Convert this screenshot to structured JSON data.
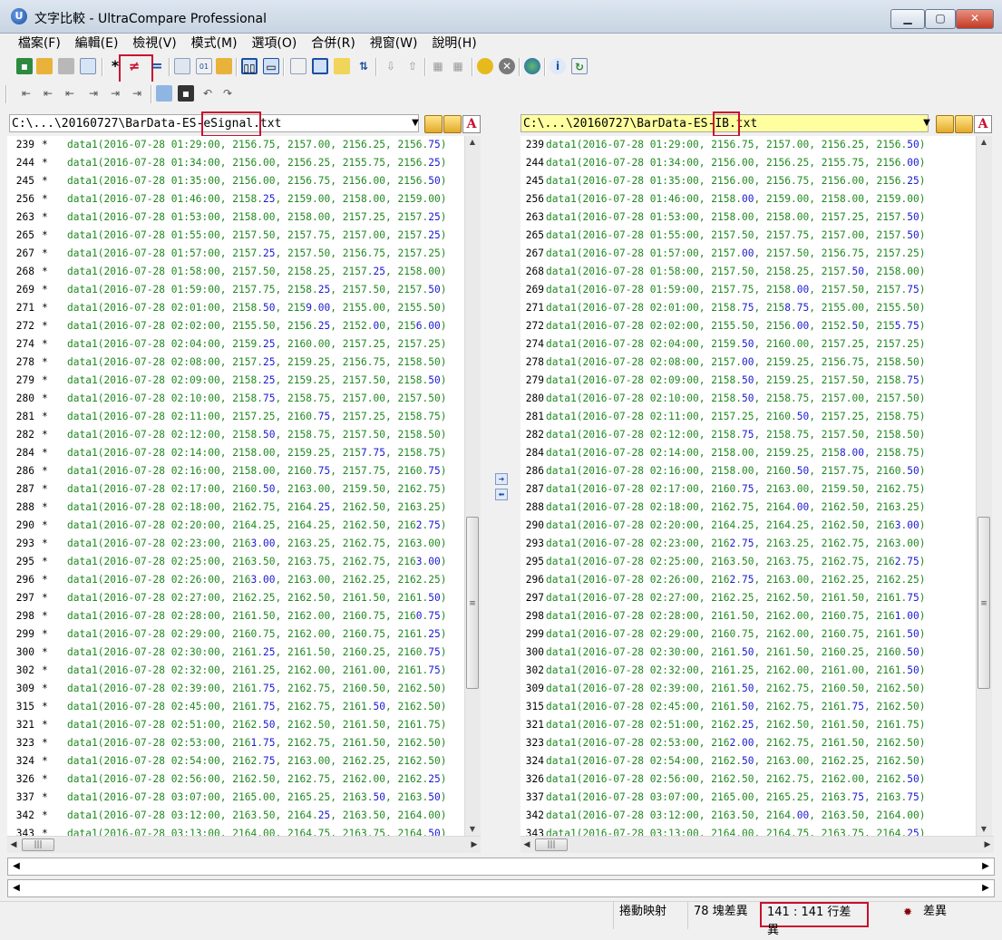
{
  "window": {
    "title": "文字比較 - UltraCompare Professional"
  },
  "menu": [
    "檔案(F)",
    "編輯(E)",
    "檢視(V)",
    "模式(M)",
    "選項(O)",
    "合併(R)",
    "視窗(W)",
    "說明(H)"
  ],
  "left": {
    "path": "C:\\...\\20160727\\BarData-ES-eSignal.txt",
    "rows": [
      {
        "n": "239",
        "t": "data1(2016-07-28 01:29:00, 2156.75, 2157.00, 2156.25, 2156.75)"
      },
      {
        "n": "244",
        "t": "data1(2016-07-28 01:34:00, 2156.00, 2156.25, 2155.75, 2156.25)"
      },
      {
        "n": "245",
        "t": "data1(2016-07-28 01:35:00, 2156.00, 2156.75, 2156.00, 2156.50)"
      },
      {
        "n": "256",
        "t": "data1(2016-07-28 01:46:00, 2158.25, 2159.00, 2158.00, 2159.00)"
      },
      {
        "n": "263",
        "t": "data1(2016-07-28 01:53:00, 2158.00, 2158.00, 2157.25, 2157.25)"
      },
      {
        "n": "265",
        "t": "data1(2016-07-28 01:55:00, 2157.50, 2157.75, 2157.00, 2157.25)"
      },
      {
        "n": "267",
        "t": "data1(2016-07-28 01:57:00, 2157.25, 2157.50, 2156.75, 2157.25)"
      },
      {
        "n": "268",
        "t": "data1(2016-07-28 01:58:00, 2157.50, 2158.25, 2157.25, 2158.00)"
      },
      {
        "n": "269",
        "t": "data1(2016-07-28 01:59:00, 2157.75, 2158.25, 2157.50, 2157.50)"
      },
      {
        "n": "271",
        "t": "data1(2016-07-28 02:01:00, 2158.50, 2159.00, 2155.00, 2155.50)"
      },
      {
        "n": "272",
        "t": "data1(2016-07-28 02:02:00, 2155.50, 2156.25, 2152.00, 2156.00)"
      },
      {
        "n": "274",
        "t": "data1(2016-07-28 02:04:00, 2159.25, 2160.00, 2157.25, 2157.25)"
      },
      {
        "n": "278",
        "t": "data1(2016-07-28 02:08:00, 2157.25, 2159.25, 2156.75, 2158.50)"
      },
      {
        "n": "279",
        "t": "data1(2016-07-28 02:09:00, 2158.25, 2159.25, 2157.50, 2158.50)"
      },
      {
        "n": "280",
        "t": "data1(2016-07-28 02:10:00, 2158.75, 2158.75, 2157.00, 2157.50)"
      },
      {
        "n": "281",
        "t": "data1(2016-07-28 02:11:00, 2157.25, 2160.75, 2157.25, 2158.75)"
      },
      {
        "n": "282",
        "t": "data1(2016-07-28 02:12:00, 2158.50, 2158.75, 2157.50, 2158.50)"
      },
      {
        "n": "284",
        "t": "data1(2016-07-28 02:14:00, 2158.00, 2159.25, 2157.75, 2158.75)"
      },
      {
        "n": "286",
        "t": "data1(2016-07-28 02:16:00, 2158.00, 2160.75, 2157.75, 2160.75)"
      },
      {
        "n": "287",
        "t": "data1(2016-07-28 02:17:00, 2160.50, 2163.00, 2159.50, 2162.75)"
      },
      {
        "n": "288",
        "t": "data1(2016-07-28 02:18:00, 2162.75, 2164.25, 2162.50, 2163.25)"
      },
      {
        "n": "290",
        "t": "data1(2016-07-28 02:20:00, 2164.25, 2164.25, 2162.50, 2162.75)"
      },
      {
        "n": "293",
        "t": "data1(2016-07-28 02:23:00, 2163.00, 2163.25, 2162.75, 2163.00)"
      },
      {
        "n": "295",
        "t": "data1(2016-07-28 02:25:00, 2163.50, 2163.75, 2162.75, 2163.00)"
      },
      {
        "n": "296",
        "t": "data1(2016-07-28 02:26:00, 2163.00, 2163.00, 2162.25, 2162.25)"
      },
      {
        "n": "297",
        "t": "data1(2016-07-28 02:27:00, 2162.25, 2162.50, 2161.50, 2161.50)"
      },
      {
        "n": "298",
        "t": "data1(2016-07-28 02:28:00, 2161.50, 2162.00, 2160.75, 2160.75)"
      },
      {
        "n": "299",
        "t": "data1(2016-07-28 02:29:00, 2160.75, 2162.00, 2160.75, 2161.25)"
      },
      {
        "n": "300",
        "t": "data1(2016-07-28 02:30:00, 2161.25, 2161.50, 2160.25, 2160.75)"
      },
      {
        "n": "302",
        "t": "data1(2016-07-28 02:32:00, 2161.25, 2162.00, 2161.00, 2161.75)"
      },
      {
        "n": "309",
        "t": "data1(2016-07-28 02:39:00, 2161.75, 2162.75, 2160.50, 2162.50)"
      },
      {
        "n": "315",
        "t": "data1(2016-07-28 02:45:00, 2161.75, 2162.75, 2161.50, 2162.50)"
      },
      {
        "n": "321",
        "t": "data1(2016-07-28 02:51:00, 2162.50, 2162.50, 2161.50, 2161.75)"
      },
      {
        "n": "323",
        "t": "data1(2016-07-28 02:53:00, 2161.75, 2162.75, 2161.50, 2162.50)"
      },
      {
        "n": "324",
        "t": "data1(2016-07-28 02:54:00, 2162.75, 2163.00, 2162.25, 2162.50)"
      },
      {
        "n": "326",
        "t": "data1(2016-07-28 02:56:00, 2162.50, 2162.75, 2162.00, 2162.25)"
      },
      {
        "n": "337",
        "t": "data1(2016-07-28 03:07:00, 2165.00, 2165.25, 2163.50, 2163.50)"
      },
      {
        "n": "342",
        "t": "data1(2016-07-28 03:12:00, 2163.50, 2164.25, 2163.50, 2164.00)"
      },
      {
        "n": "343",
        "t": "data1(2016-07-28 03:13:00, 2164.00, 2164.75, 2163.75, 2164.50)"
      }
    ]
  },
  "right": {
    "path": "C:\\...\\20160727\\BarData-ES-IB.txt",
    "rows": [
      {
        "n": "239",
        "t": "data1(2016-07-28 01:29:00, 2156.75, 2157.00, 2156.25, 2156.50)"
      },
      {
        "n": "244",
        "t": "data1(2016-07-28 01:34:00, 2156.00, 2156.25, 2155.75, 2156.00)"
      },
      {
        "n": "245",
        "t": "data1(2016-07-28 01:35:00, 2156.00, 2156.75, 2156.00, 2156.25)"
      },
      {
        "n": "256",
        "t": "data1(2016-07-28 01:46:00, 2158.00, 2159.00, 2158.00, 2159.00)"
      },
      {
        "n": "263",
        "t": "data1(2016-07-28 01:53:00, 2158.00, 2158.00, 2157.25, 2157.50)"
      },
      {
        "n": "265",
        "t": "data1(2016-07-28 01:55:00, 2157.50, 2157.75, 2157.00, 2157.50)"
      },
      {
        "n": "267",
        "t": "data1(2016-07-28 01:57:00, 2157.00, 2157.50, 2156.75, 2157.25)"
      },
      {
        "n": "268",
        "t": "data1(2016-07-28 01:58:00, 2157.50, 2158.25, 2157.50, 2158.00)"
      },
      {
        "n": "269",
        "t": "data1(2016-07-28 01:59:00, 2157.75, 2158.00, 2157.50, 2157.75)"
      },
      {
        "n": "271",
        "t": "data1(2016-07-28 02:01:00, 2158.75, 2158.75, 2155.00, 2155.50)"
      },
      {
        "n": "272",
        "t": "data1(2016-07-28 02:02:00, 2155.50, 2156.00, 2152.50, 2155.75)"
      },
      {
        "n": "274",
        "t": "data1(2016-07-28 02:04:00, 2159.50, 2160.00, 2157.25, 2157.25)"
      },
      {
        "n": "278",
        "t": "data1(2016-07-28 02:08:00, 2157.00, 2159.25, 2156.75, 2158.50)"
      },
      {
        "n": "279",
        "t": "data1(2016-07-28 02:09:00, 2158.50, 2159.25, 2157.50, 2158.75)"
      },
      {
        "n": "280",
        "t": "data1(2016-07-28 02:10:00, 2158.50, 2158.75, 2157.00, 2157.50)"
      },
      {
        "n": "281",
        "t": "data1(2016-07-28 02:11:00, 2157.25, 2160.50, 2157.25, 2158.75)"
      },
      {
        "n": "282",
        "t": "data1(2016-07-28 02:12:00, 2158.75, 2158.75, 2157.50, 2158.50)"
      },
      {
        "n": "284",
        "t": "data1(2016-07-28 02:14:00, 2158.00, 2159.25, 2158.00, 2158.75)"
      },
      {
        "n": "286",
        "t": "data1(2016-07-28 02:16:00, 2158.00, 2160.50, 2157.75, 2160.50)"
      },
      {
        "n": "287",
        "t": "data1(2016-07-28 02:17:00, 2160.75, 2163.00, 2159.50, 2162.75)"
      },
      {
        "n": "288",
        "t": "data1(2016-07-28 02:18:00, 2162.75, 2164.00, 2162.50, 2163.25)"
      },
      {
        "n": "290",
        "t": "data1(2016-07-28 02:20:00, 2164.25, 2164.25, 2162.50, 2163.00)"
      },
      {
        "n": "293",
        "t": "data1(2016-07-28 02:23:00, 2162.75, 2163.25, 2162.75, 2163.00)"
      },
      {
        "n": "295",
        "t": "data1(2016-07-28 02:25:00, 2163.50, 2163.75, 2162.75, 2162.75)"
      },
      {
        "n": "296",
        "t": "data1(2016-07-28 02:26:00, 2162.75, 2163.00, 2162.25, 2162.25)"
      },
      {
        "n": "297",
        "t": "data1(2016-07-28 02:27:00, 2162.25, 2162.50, 2161.50, 2161.75)"
      },
      {
        "n": "298",
        "t": "data1(2016-07-28 02:28:00, 2161.50, 2162.00, 2160.75, 2161.00)"
      },
      {
        "n": "299",
        "t": "data1(2016-07-28 02:29:00, 2160.75, 2162.00, 2160.75, 2161.50)"
      },
      {
        "n": "300",
        "t": "data1(2016-07-28 02:30:00, 2161.50, 2161.50, 2160.25, 2160.50)"
      },
      {
        "n": "302",
        "t": "data1(2016-07-28 02:32:00, 2161.25, 2162.00, 2161.00, 2161.50)"
      },
      {
        "n": "309",
        "t": "data1(2016-07-28 02:39:00, 2161.50, 2162.75, 2160.50, 2162.50)"
      },
      {
        "n": "315",
        "t": "data1(2016-07-28 02:45:00, 2161.50, 2162.75, 2161.75, 2162.50)"
      },
      {
        "n": "321",
        "t": "data1(2016-07-28 02:51:00, 2162.25, 2162.50, 2161.50, 2161.75)"
      },
      {
        "n": "323",
        "t": "data1(2016-07-28 02:53:00, 2162.00, 2162.75, 2161.50, 2162.50)"
      },
      {
        "n": "324",
        "t": "data1(2016-07-28 02:54:00, 2162.50, 2163.00, 2162.25, 2162.50)"
      },
      {
        "n": "326",
        "t": "data1(2016-07-28 02:56:00, 2162.50, 2162.75, 2162.00, 2162.50)"
      },
      {
        "n": "337",
        "t": "data1(2016-07-28 03:07:00, 2165.00, 2165.25, 2163.75, 2163.75)"
      },
      {
        "n": "342",
        "t": "data1(2016-07-28 03:12:00, 2163.50, 2164.00, 2163.50, 2164.00)"
      },
      {
        "n": "343",
        "t": "data1(2016-07-28 03:13:00, 2164.00, 2164.75, 2163.75, 2164.25)"
      }
    ]
  },
  "diff_marker": "*",
  "status": {
    "scroll_map": "捲動映射",
    "block_diffs": "78 塊差異",
    "line_diffs": "141 : 141 行差異",
    "diff_label": "差異"
  },
  "colors": {
    "code_green": "#1f8a1f",
    "diff_blue": "#1a1ad0",
    "highlight_red": "#c8102e",
    "right_path_bg": "#ffffa0"
  }
}
